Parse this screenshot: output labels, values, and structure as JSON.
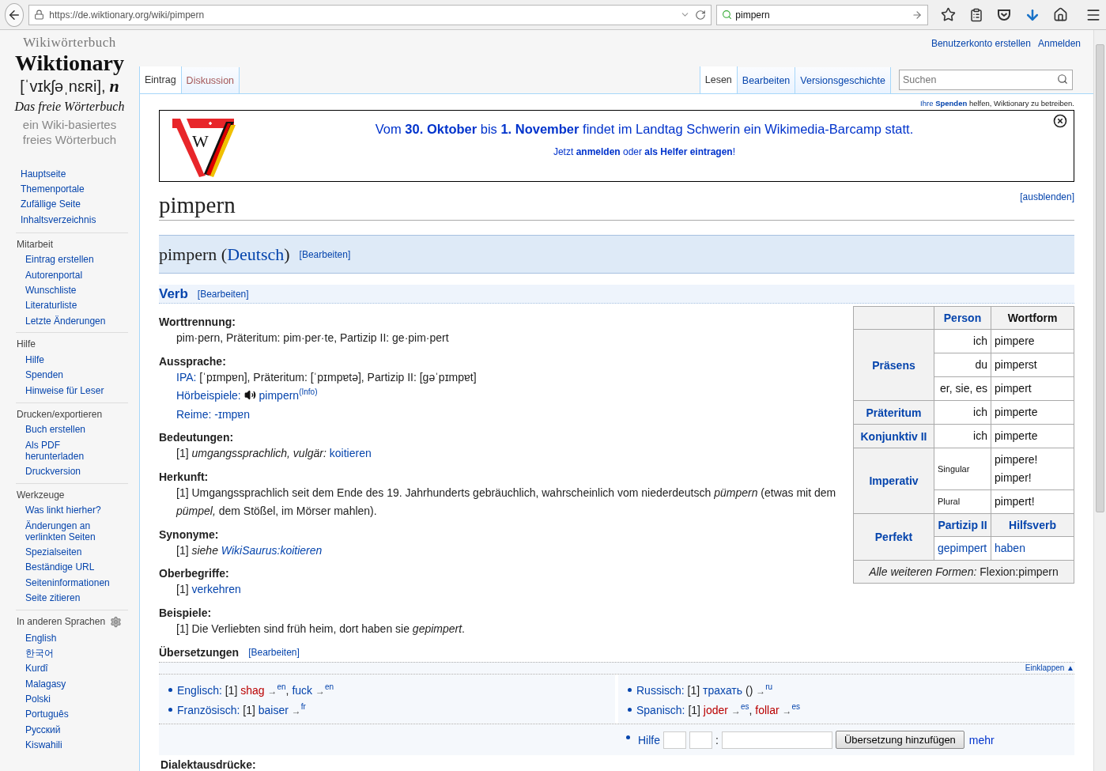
{
  "browser": {
    "url": "https://de.wiktionary.org/wiki/pimpern",
    "search": "pimpern"
  },
  "sidebar": {
    "logo": {
      "kicker": "Wikiwörterbuch",
      "title": "Wiktionary",
      "pronunciation": "[ˈvɪkʃəˌnɛʀi],",
      "gender": "n",
      "motto": "Das freie Wörterbuch",
      "subtitle": "ein Wiki-basiertes freies Wörterbuch"
    },
    "nav": [
      "Hauptseite",
      "Themenportale",
      "Zufällige Seite",
      "Inhaltsverzeichnis"
    ],
    "sections": [
      {
        "heading": "Mitarbeit",
        "kind": "links",
        "items": [
          "Eintrag erstellen",
          "Autorenportal",
          "Wunschliste",
          "Literaturliste",
          "Letzte Änderungen"
        ]
      },
      {
        "heading": "Hilfe",
        "kind": "links",
        "items": [
          "Hilfe",
          "Spenden",
          "Hinweise für Leser"
        ]
      },
      {
        "heading": "Drucken/exportieren",
        "kind": "links",
        "items": [
          "Buch erstellen",
          "Als PDF herunterladen",
          "Druckversion"
        ]
      },
      {
        "heading": "Werkzeuge",
        "kind": "links",
        "items": [
          "Was linkt hierher?",
          "Änderungen an verlinkten Seiten",
          "Spezialseiten",
          "Beständige URL",
          "Seiteninformationen",
          "Seite zitieren"
        ]
      },
      {
        "heading": "In anderen Sprachen",
        "kind": "languages",
        "items": [
          "English",
          "한국어",
          "Kurdî",
          "Malagasy",
          "Polski",
          "Português",
          "Русский",
          "Kiswahili"
        ]
      }
    ]
  },
  "user_links": [
    "Benutzerkonto erstellen",
    "Anmelden"
  ],
  "tabs_left": [
    {
      "label": "Eintrag",
      "selected": true,
      "redlink": false
    },
    {
      "label": "Diskussion",
      "selected": false,
      "redlink": true
    }
  ],
  "tabs_right": [
    {
      "label": "Lesen",
      "selected": true
    },
    {
      "label": "Bearbeiten",
      "selected": false
    },
    {
      "label": "Versionsgeschichte",
      "selected": false
    }
  ],
  "search": {
    "placeholder": "Suchen"
  },
  "donate_note": [
    {
      "kind": "link",
      "text": "Ihre"
    },
    {
      "kind": "boldlink",
      "text": "Spenden"
    },
    {
      "kind": "text",
      "text": "helfen, Wiktionary zu betreiben."
    }
  ],
  "banner": {
    "logo_letter": "W",
    "headline": "Vom **30. Oktober** bis **1. November** findet im Landtag Schwerin ein Wikimedia-Barcamp statt.",
    "subline": "Jetzt **anmelden** oder **als Helfer eintragen**!"
  },
  "title": "pimpern",
  "hide_link": "[ausblenden]",
  "language_heading": [
    {
      "kind": "text",
      "text": "pimpern ("
    },
    {
      "kind": "link",
      "text": "Deutsch",
      "tight": true
    },
    {
      "kind": "text",
      "text": ")",
      "tight": true
    }
  ],
  "language_edit": "[Bearbeiten]",
  "pos_heading": "Verb",
  "pos_edit": "[Bearbeiten]",
  "sections": [
    {
      "heading": "Worttrennung:",
      "lines": [
        [
          {
            "kind": "text",
            "text": "pim·pern, Präteritum: pim·per·te, Partizip II: ge·pim·pert"
          }
        ]
      ]
    },
    {
      "heading": "Aussprache:",
      "lines": [
        [
          {
            "kind": "link",
            "text": "IPA:"
          },
          {
            "kind": "text",
            "text": "[ˈpɪmpɐn], Präteritum: [ˈpɪmpɐtə], Partizip II: [ɡəˈpɪmpɐt]"
          }
        ],
        [
          {
            "kind": "link",
            "text": "Hörbeispiele:"
          },
          {
            "kind": "audio"
          },
          {
            "kind": "link",
            "text": "pimpern"
          },
          {
            "kind": "sup",
            "text": "(Info)"
          }
        ],
        [
          {
            "kind": "link",
            "text": "Reime:"
          },
          {
            "kind": "link",
            "text": "-ɪmpɐn"
          }
        ]
      ]
    },
    {
      "heading": "Bedeutungen:",
      "lines": [
        [
          {
            "kind": "text",
            "text": "[1] *umgangssprachlich, vulgär:*"
          },
          {
            "kind": "link",
            "text": "koitieren"
          }
        ]
      ]
    },
    {
      "heading": "Herkunft:",
      "lines": [
        [
          {
            "kind": "text",
            "text": "[1] Umgangssprachlich seit dem Ende des 19. Jahrhunderts gebräuchlich, wahrscheinlich vom niederdeutsch *pümpern* (etwas mit dem *pümpel,* dem Stößel, im Mörser mahlen)."
          }
        ]
      ]
    },
    {
      "heading": "Synonyme:",
      "lines": [
        [
          {
            "kind": "text",
            "text": "[1] *siehe*"
          },
          {
            "kind": "italiclink",
            "text": "WikiSaurus:koitieren"
          }
        ]
      ]
    },
    {
      "heading": "Oberbegriffe:",
      "lines": [
        [
          {
            "kind": "text",
            "text": "[1]"
          },
          {
            "kind": "link",
            "text": "verkehren"
          }
        ]
      ]
    },
    {
      "heading": "Beispiele:",
      "lines": [
        [
          {
            "kind": "text",
            "text": "[1] Die Verliebten sind früh heim, dort haben sie *gepimpert*."
          }
        ]
      ]
    }
  ],
  "conjugation": {
    "header": [
      "Person",
      "Wortform"
    ],
    "groups": [
      {
        "kind": "tense",
        "label": "Präsens",
        "rows": [
          {
            "kind": "person",
            "person": "ich",
            "form": [
              "pimpere"
            ]
          },
          {
            "kind": "person",
            "person": "du",
            "form": [
              "pimperst"
            ]
          },
          {
            "kind": "person",
            "person": "er, sie, es",
            "form": [
              "pimpert"
            ]
          }
        ]
      },
      {
        "kind": "tense",
        "label": "Präteritum",
        "rows": [
          {
            "kind": "person",
            "person": "ich",
            "form": [
              "pimperte"
            ]
          }
        ]
      },
      {
        "kind": "tense",
        "label": "Konjunktiv II",
        "rows": [
          {
            "kind": "person",
            "person": "ich",
            "form": [
              "pimperte"
            ]
          }
        ]
      },
      {
        "kind": "tense",
        "label": "Imperativ",
        "rows": [
          {
            "kind": "number",
            "person": "Singular",
            "form": [
              "pimpere!",
              "pimper!"
            ]
          },
          {
            "kind": "number",
            "person": "Plural",
            "form": [
              "pimpert!"
            ]
          }
        ]
      },
      {
        "kind": "perfect",
        "label": "Perfekt",
        "subheader": [
          "Partizip II",
          "Hilfsverb"
        ],
        "values": [
          "gepimpert",
          "haben"
        ]
      }
    ],
    "footer": "*Alle weiteren Formen:* Flexion:pimpern"
  },
  "translations": {
    "heading": "Übersetzungen",
    "edit": "[Bearbeiten]",
    "collapse": "Einklappen ▲",
    "columns": [
      [
        {
          "language": "Englisch:",
          "segments": [
            {
              "kind": "text",
              "text": "[1]"
            },
            {
              "kind": "redlink",
              "text": "shag"
            },
            {
              "kind": "arrow",
              "text": "→"
            },
            {
              "kind": "sup",
              "text": "en"
            },
            {
              "kind": "text",
              "text": ",",
              "tight": true
            },
            {
              "kind": "link",
              "text": "fuck"
            },
            {
              "kind": "arrow",
              "text": "→"
            },
            {
              "kind": "sup",
              "text": "en"
            }
          ]
        },
        {
          "language": "Französisch:",
          "segments": [
            {
              "kind": "text",
              "text": "[1]"
            },
            {
              "kind": "link",
              "text": "baiser"
            },
            {
              "kind": "arrow",
              "text": "→"
            },
            {
              "kind": "sup",
              "text": "fr"
            }
          ]
        }
      ],
      [
        {
          "language": "Russisch:",
          "segments": [
            {
              "kind": "text",
              "text": "[1]"
            },
            {
              "kind": "link",
              "text": "трахать"
            },
            {
              "kind": "text",
              "text": "()"
            },
            {
              "kind": "arrow",
              "text": "→"
            },
            {
              "kind": "sup",
              "text": "ru"
            }
          ]
        },
        {
          "language": "Spanisch:",
          "segments": [
            {
              "kind": "text",
              "text": "[1]"
            },
            {
              "kind": "redlink",
              "text": "joder"
            },
            {
              "kind": "arrow",
              "text": "→"
            },
            {
              "kind": "sup",
              "text": "es"
            },
            {
              "kind": "text",
              "text": ",",
              "tight": true
            },
            {
              "kind": "redlink",
              "text": "follar"
            },
            {
              "kind": "arrow",
              "text": "→"
            },
            {
              "kind": "sup",
              "text": "es"
            }
          ]
        }
      ]
    ],
    "add_form": {
      "help": "Hilfe",
      "separator": ":",
      "button": "Übersetzung hinzufügen",
      "more": "mehr"
    }
  },
  "next_heading": "Dialektausdrücke:"
}
